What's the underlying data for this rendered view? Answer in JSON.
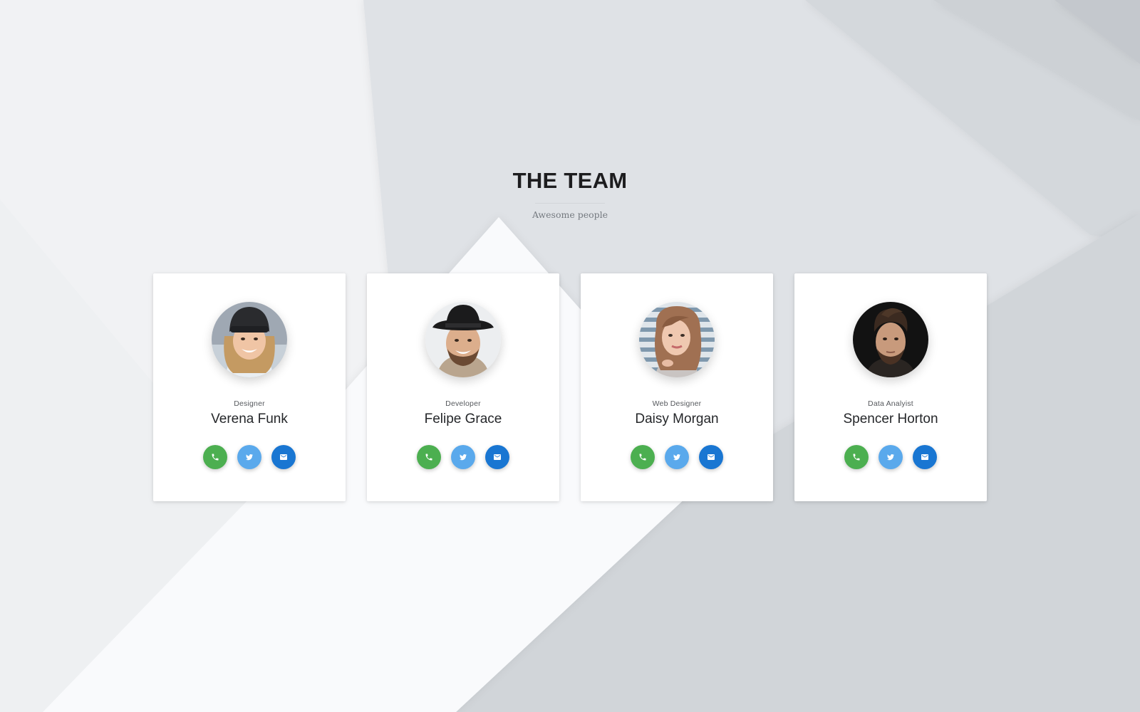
{
  "header": {
    "title": "THE TEAM",
    "subtitle": "Awesome people"
  },
  "colors": {
    "phone": "#4caf50",
    "twitter": "#5aa9ec",
    "email": "#1976d2",
    "card": "#ffffff",
    "title": "#1d1d1f"
  },
  "members": [
    {
      "role": "Designer",
      "name": "Verena Funk",
      "photo": "woman-black-beanie-smiling-photo",
      "actions": [
        "phone-icon",
        "twitter-icon",
        "email-icon"
      ]
    },
    {
      "role": "Developer",
      "name": "Felipe Grace",
      "photo": "man-black-hat-smiling-photo",
      "actions": [
        "phone-icon",
        "twitter-icon",
        "email-icon"
      ]
    },
    {
      "role": "Web Designer",
      "name": "Daisy Morgan",
      "photo": "woman-blonde-striped-background-photo",
      "actions": [
        "phone-icon",
        "twitter-icon",
        "email-icon"
      ]
    },
    {
      "role": "Data Analyist",
      "name": "Spencer Horton",
      "photo": "man-dark-hair-dark-background-photo",
      "actions": [
        "phone-icon",
        "twitter-icon",
        "email-icon"
      ]
    }
  ]
}
